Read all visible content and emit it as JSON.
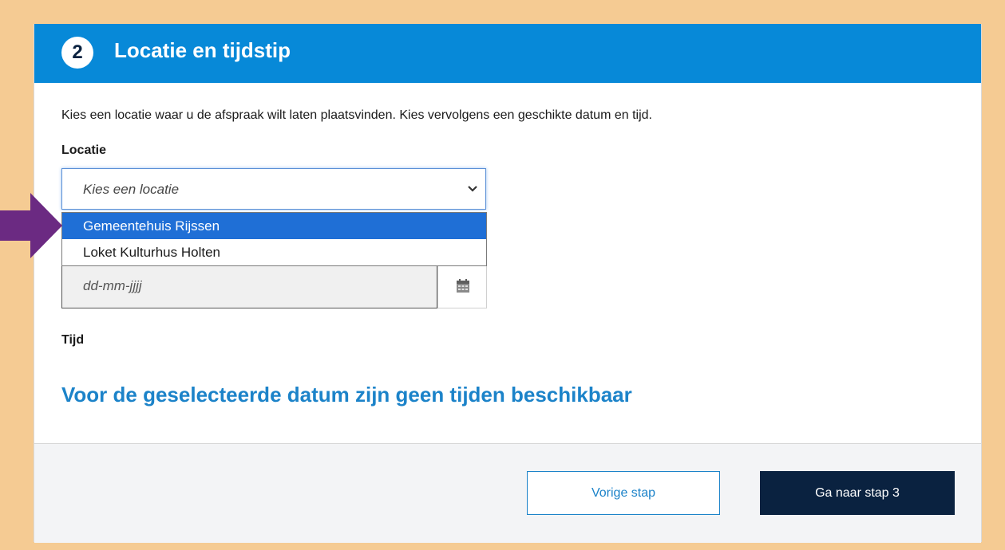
{
  "step": {
    "number": "2",
    "title": "Locatie en tijdstip"
  },
  "intro_text": "Kies een locatie waar u de afspraak wilt laten plaatsvinden. Kies vervolgens een geschikte datum en tijd.",
  "location": {
    "label": "Locatie",
    "placeholder": "Kies een locatie",
    "options": [
      {
        "label": "Gemeentehuis Rijssen",
        "highlighted": true
      },
      {
        "label": "Loket Kulturhus Holten",
        "highlighted": false
      }
    ]
  },
  "date": {
    "placeholder": "dd-mm-jjjj"
  },
  "time": {
    "label": "Tijd",
    "no_times_message": "Voor de geselecteerde datum zijn geen tijden beschikbaar"
  },
  "buttons": {
    "previous": "Vorige stap",
    "next": "Ga naar stap 3"
  },
  "colors": {
    "header_blue": "#0789d8",
    "highlight_blue": "#1f6fd6",
    "navy": "#0a2240",
    "link_blue": "#1c83c9",
    "frame_orange": "#f5cb93",
    "arrow_purple": "#6b2a82"
  },
  "icons": {
    "dropdown": "chevron-down-icon",
    "calendar": "calendar-icon",
    "pointer": "arrow-right-icon"
  }
}
